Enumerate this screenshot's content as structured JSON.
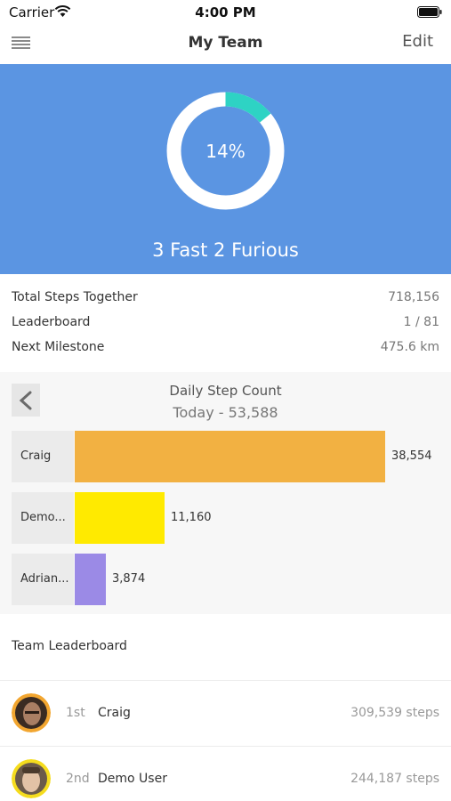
{
  "status_bar": {
    "carrier": "Carrier",
    "time": "4:00 PM"
  },
  "nav": {
    "title": "My Team",
    "edit_label": "Edit"
  },
  "hero": {
    "progress_label": "14%",
    "progress": 0.14,
    "team_name": "3 Fast 2 Furious"
  },
  "stats": [
    {
      "label": "Total Steps Together",
      "value": "718,156"
    },
    {
      "label": "Leaderboard",
      "value": "1 / 81"
    },
    {
      "label": "Next Milestone",
      "value": "475.6 km"
    }
  ],
  "daily": {
    "title": "Daily Step Count",
    "subtitle": "Today - 53,588"
  },
  "chart_data": {
    "type": "bar",
    "orientation": "horizontal",
    "title": "Daily Step Count",
    "subtitle": "Today - 53,588",
    "categories": [
      "Craig",
      "Demo...",
      "Adrian..."
    ],
    "values": [
      38554,
      11160,
      3874
    ],
    "value_labels": [
      "38,554",
      "11,160",
      "3,874"
    ],
    "colors": [
      "#f2b142",
      "#ffea00",
      "#9b8ae6"
    ],
    "xlim": [
      0,
      38554
    ]
  },
  "leaderboard": {
    "title": "Team Leaderboard",
    "entries": [
      {
        "rank": "1st",
        "name": "Craig",
        "steps": "309,539 steps",
        "ring_color": "#f2a630"
      },
      {
        "rank": "2nd",
        "name": "Demo User",
        "steps": "244,187 steps",
        "ring_color": "#f5dc1e"
      }
    ]
  },
  "colors": {
    "hero": "#5b95e2",
    "ring_track": "#ffffff",
    "ring_progress": "#2ed3c4"
  }
}
